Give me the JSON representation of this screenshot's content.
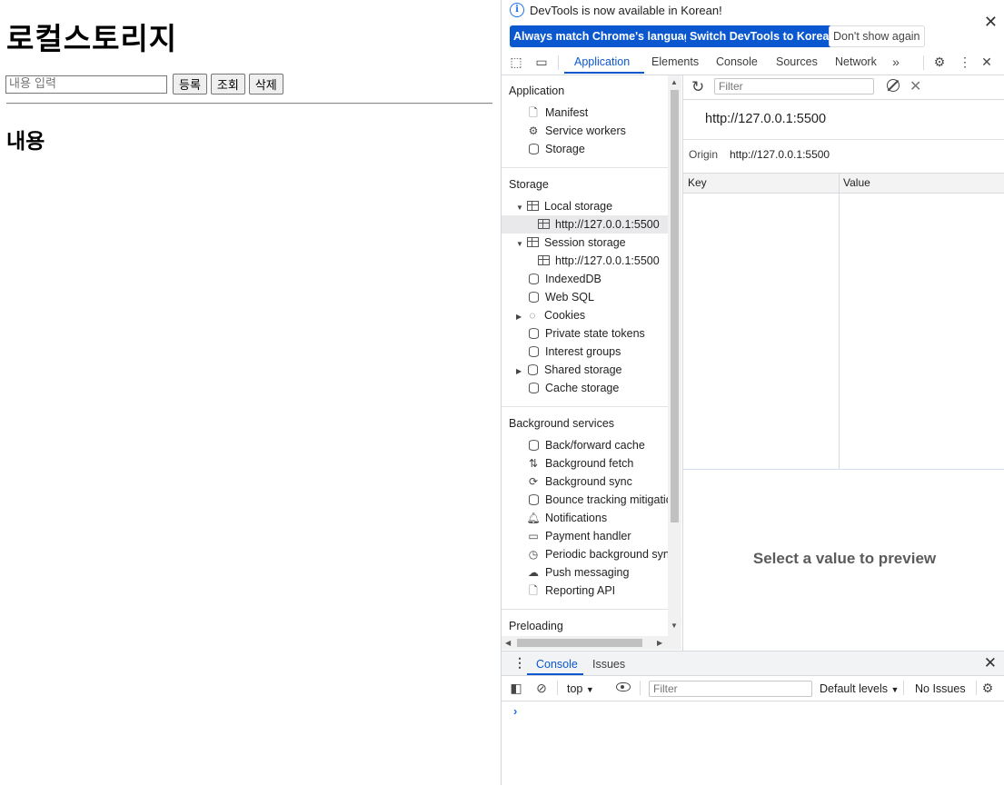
{
  "page": {
    "title": "로컬스토리지",
    "input_placeholder": "내용 입력",
    "buttons": {
      "register": "등록",
      "view": "조회",
      "delete": "삭제"
    },
    "content_heading": "내용"
  },
  "devtools": {
    "infobar": {
      "message": "DevTools is now available in Korean!",
      "btn_match": "Always match Chrome's language",
      "btn_switch": "Switch DevTools to Korean",
      "btn_dont_show": "Don't show again"
    },
    "tabs": [
      "Application",
      "Elements",
      "Console",
      "Sources",
      "Network"
    ],
    "sidebar": {
      "application_title": "Application",
      "application_items": [
        "Manifest",
        "Service workers",
        "Storage"
      ],
      "storage_title": "Storage",
      "local_storage": "Local storage",
      "local_origin": "http://127.0.0.1:5500",
      "session_storage": "Session storage",
      "session_origin": "http://127.0.0.1:5500",
      "storage_items": [
        "IndexedDB",
        "Web SQL",
        "Cookies",
        "Private state tokens",
        "Interest groups",
        "Shared storage",
        "Cache storage"
      ],
      "background_title": "Background services",
      "background_items": [
        "Back/forward cache",
        "Background fetch",
        "Background sync",
        "Bounce tracking mitigatic",
        "Notifications",
        "Payment handler",
        "Periodic background sync",
        "Push messaging",
        "Reporting API"
      ],
      "preloading_title": "Preloading"
    },
    "main": {
      "filter_placeholder": "Filter",
      "origin_heading": "http://127.0.0.1:5500",
      "origin_label": "Origin",
      "origin_value": "http://127.0.0.1:5500",
      "col_key": "Key",
      "col_value": "Value",
      "preview": "Select a value to preview"
    },
    "drawer": {
      "tab_console": "Console",
      "tab_issues": "Issues",
      "context": "top",
      "filter_placeholder": "Filter",
      "levels": "Default levels",
      "issues": "No Issues",
      "prompt": "›"
    },
    "colors": {
      "accent": "#0b57d0",
      "link_blue": "#1a73e8"
    }
  }
}
